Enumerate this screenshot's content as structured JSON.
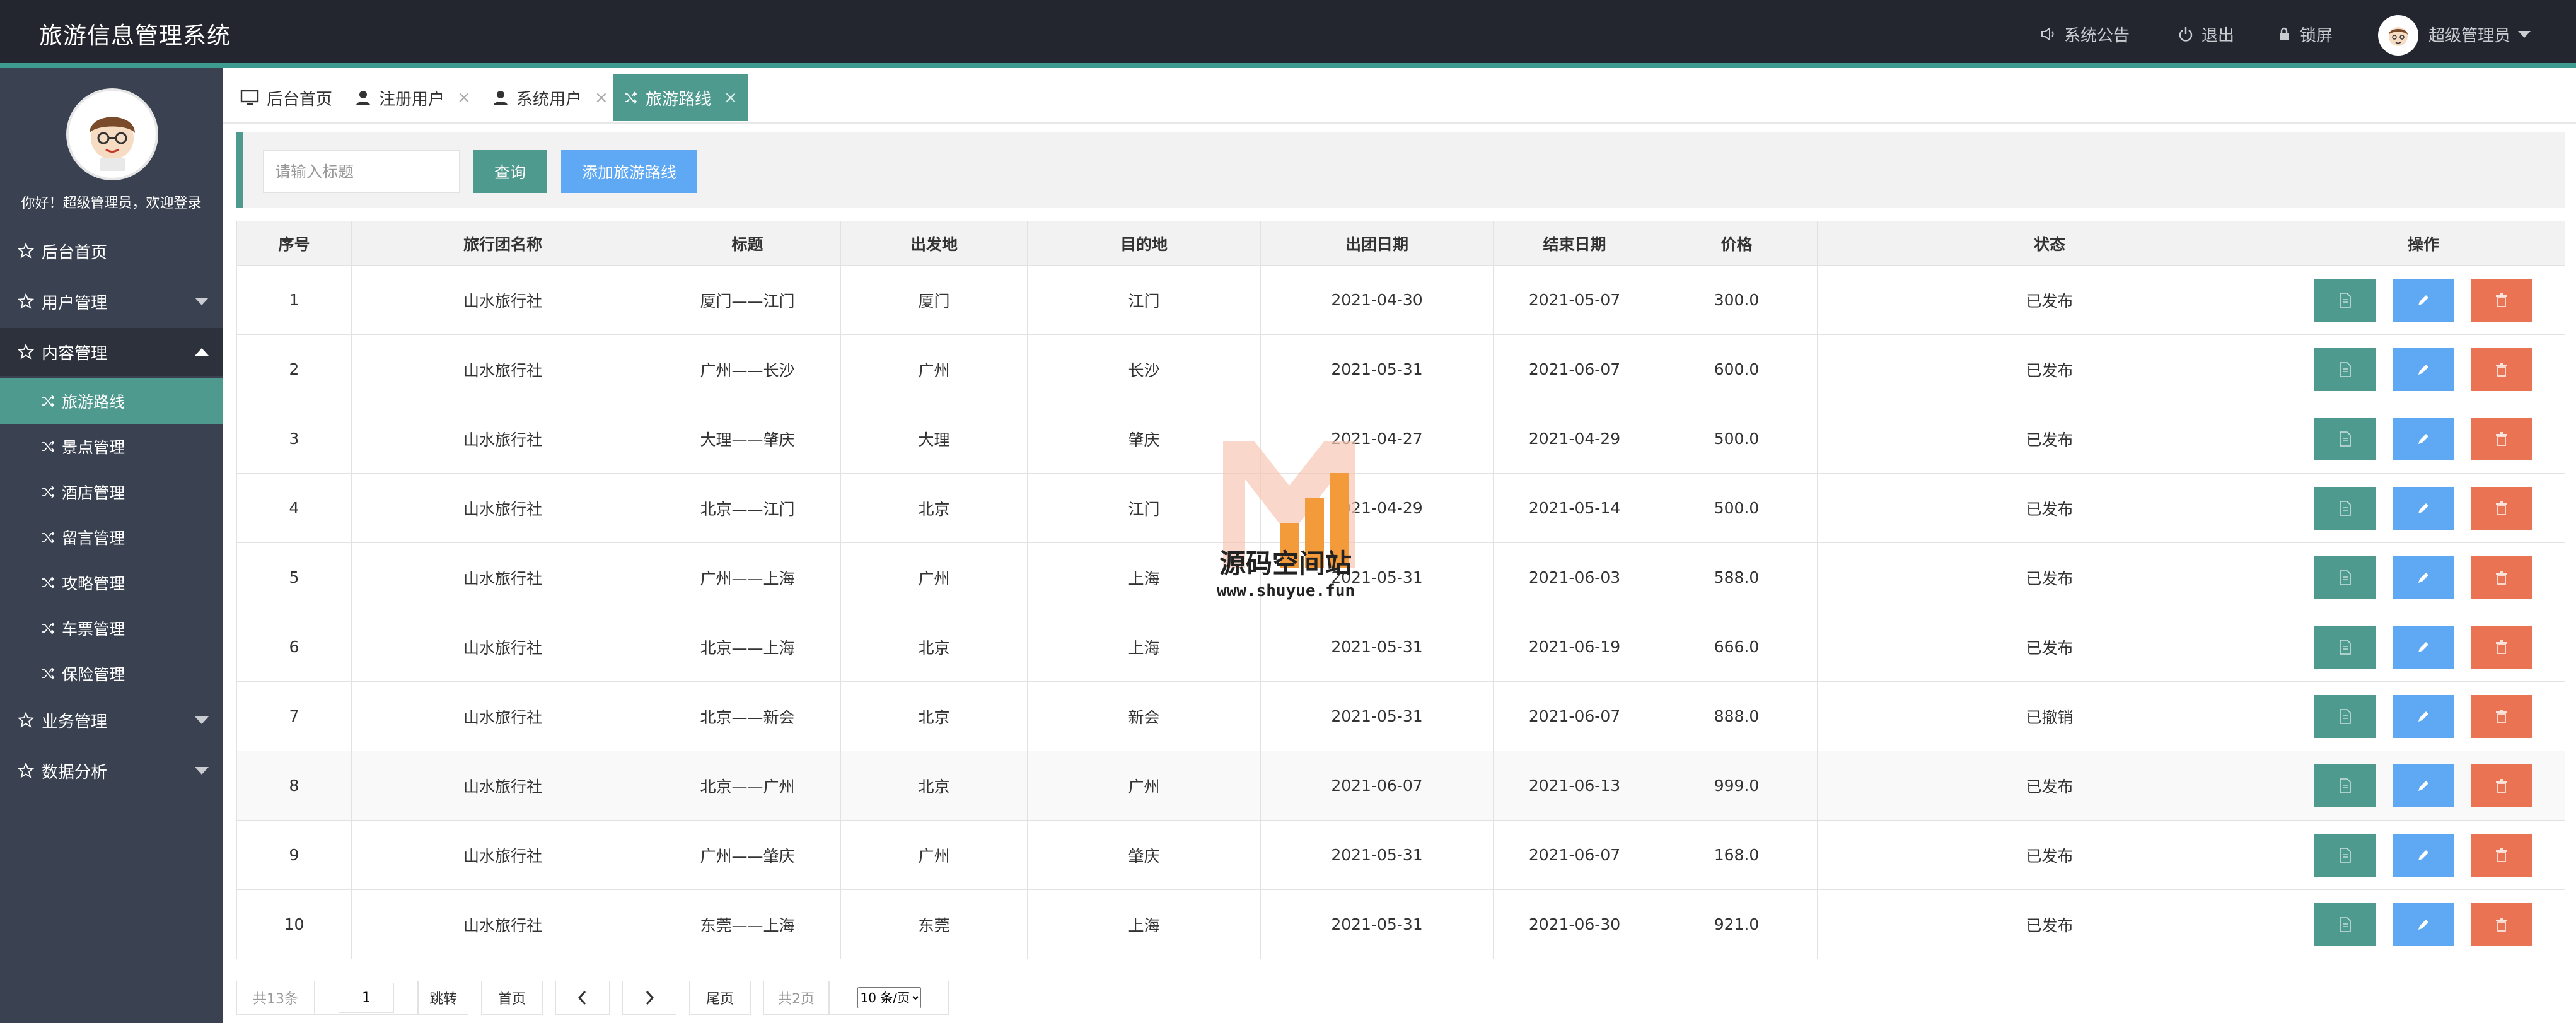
{
  "app": {
    "title": "旅游信息管理系统"
  },
  "header": {
    "announcement": "系统公告",
    "logout": "退出",
    "lock": "锁屏",
    "user": "超级管理员"
  },
  "sidebar": {
    "welcome": "你好！超级管理员，欢迎登录",
    "menu": [
      {
        "label": "后台首页"
      },
      {
        "label": "用户管理"
      },
      {
        "label": "内容管理"
      },
      {
        "label": "业务管理"
      },
      {
        "label": "数据分析"
      }
    ],
    "submenu": [
      {
        "label": "旅游路线"
      },
      {
        "label": "景点管理"
      },
      {
        "label": "酒店管理"
      },
      {
        "label": "留言管理"
      },
      {
        "label": "攻略管理"
      },
      {
        "label": "车票管理"
      },
      {
        "label": "保险管理"
      }
    ]
  },
  "tabs": [
    {
      "label": "后台首页"
    },
    {
      "label": "注册用户"
    },
    {
      "label": "系统用户"
    },
    {
      "label": "旅游路线"
    }
  ],
  "toolbar": {
    "search_placeholder": "请输入标题",
    "query_label": "查询",
    "add_label": "添加旅游路线"
  },
  "table": {
    "headers": [
      "序号",
      "旅行团名称",
      "标题",
      "出发地",
      "目的地",
      "出团日期",
      "结束日期",
      "价格",
      "状态",
      "操作"
    ],
    "rows": [
      {
        "no": "1",
        "group": "山水旅行社",
        "title": "厦门——江门",
        "from": "厦门",
        "to": "江门",
        "start": "2021-04-30",
        "end": "2021-05-07",
        "price": "300.0",
        "status": "已发布"
      },
      {
        "no": "2",
        "group": "山水旅行社",
        "title": "广州——长沙",
        "from": "广州",
        "to": "长沙",
        "start": "2021-05-31",
        "end": "2021-06-07",
        "price": "600.0",
        "status": "已发布"
      },
      {
        "no": "3",
        "group": "山水旅行社",
        "title": "大理——肇庆",
        "from": "大理",
        "to": "肇庆",
        "start": "2021-04-27",
        "end": "2021-04-29",
        "price": "500.0",
        "status": "已发布"
      },
      {
        "no": "4",
        "group": "山水旅行社",
        "title": "北京——江门",
        "from": "北京",
        "to": "江门",
        "start": "2021-04-29",
        "end": "2021-05-14",
        "price": "500.0",
        "status": "已发布"
      },
      {
        "no": "5",
        "group": "山水旅行社",
        "title": "广州——上海",
        "from": "广州",
        "to": "上海",
        "start": "2021-05-31",
        "end": "2021-06-03",
        "price": "588.0",
        "status": "已发布"
      },
      {
        "no": "6",
        "group": "山水旅行社",
        "title": "北京——上海",
        "from": "北京",
        "to": "上海",
        "start": "2021-05-31",
        "end": "2021-06-19",
        "price": "666.0",
        "status": "已发布"
      },
      {
        "no": "7",
        "group": "山水旅行社",
        "title": "北京——新会",
        "from": "北京",
        "to": "新会",
        "start": "2021-05-31",
        "end": "2021-06-07",
        "price": "888.0",
        "status": "已撤销"
      },
      {
        "no": "8",
        "group": "山水旅行社",
        "title": "北京——广州",
        "from": "北京",
        "to": "广州",
        "start": "2021-06-07",
        "end": "2021-06-13",
        "price": "999.0",
        "status": "已发布"
      },
      {
        "no": "9",
        "group": "山水旅行社",
        "title": "广州——肇庆",
        "from": "广州",
        "to": "肇庆",
        "start": "2021-05-31",
        "end": "2021-06-07",
        "price": "168.0",
        "status": "已发布"
      },
      {
        "no": "10",
        "group": "山水旅行社",
        "title": "东莞——上海",
        "from": "东莞",
        "to": "上海",
        "start": "2021-05-31",
        "end": "2021-06-30",
        "price": "921.0",
        "status": "已发布"
      }
    ]
  },
  "pagination": {
    "total": "共13条",
    "current_page": "1",
    "jump": "跳转",
    "first": "首页",
    "last": "尾页",
    "pages": "共2页",
    "page_size": "10 条/页"
  },
  "watermark": {
    "text": "源码空间站",
    "url": "www.shuyue.fun"
  },
  "colors": {
    "header_bg": "#23262e",
    "sidebar_bg": "#3a4150",
    "accent": "#4f9a8e",
    "blue": "#5fa8f4",
    "orange": "#ea7353"
  }
}
